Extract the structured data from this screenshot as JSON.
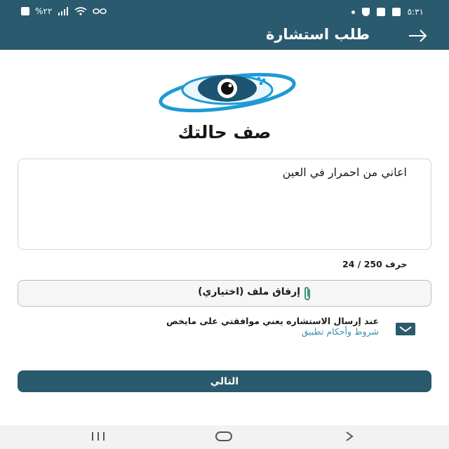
{
  "status_bar": {
    "battery": "%٢٢",
    "time": "٥:٣١"
  },
  "header": {
    "title": "طلب استشارة"
  },
  "form": {
    "heading": "صف حالتك",
    "description_value": "اعاني من احمرار في العين",
    "counter_current": "24",
    "counter_max": "250",
    "counter_unit": "حرف",
    "attach_label": "إرفاق ملف (اختياري)",
    "terms_text": "عند إرسال الاستشاره يعني موافقتي على مايخص",
    "terms_link": "شروط وأحكام تطبيق",
    "terms_checked": true,
    "next_label": "التالي"
  },
  "colors": {
    "primary": "#2a5a6d",
    "link": "#3a8fb0",
    "logo_blue": "#1e9ad6"
  }
}
